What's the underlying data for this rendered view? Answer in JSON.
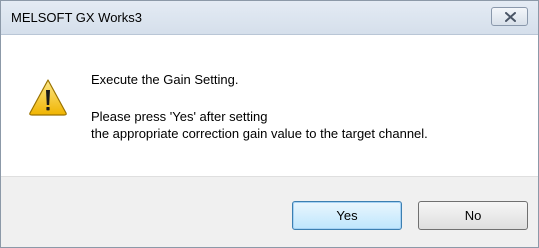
{
  "window": {
    "title": "MELSOFT GX Works3",
    "close_icon": "close-x-icon"
  },
  "message": {
    "icon": "warning-icon",
    "line1": "Execute the Gain Setting.",
    "line2": "Please press 'Yes' after setting",
    "line3": "the appropriate correction gain value to the target channel."
  },
  "buttons": {
    "yes": "Yes",
    "no": "No"
  },
  "colors": {
    "warning_fill": "#f5c400",
    "default_button_border": "#3c7fb1"
  }
}
